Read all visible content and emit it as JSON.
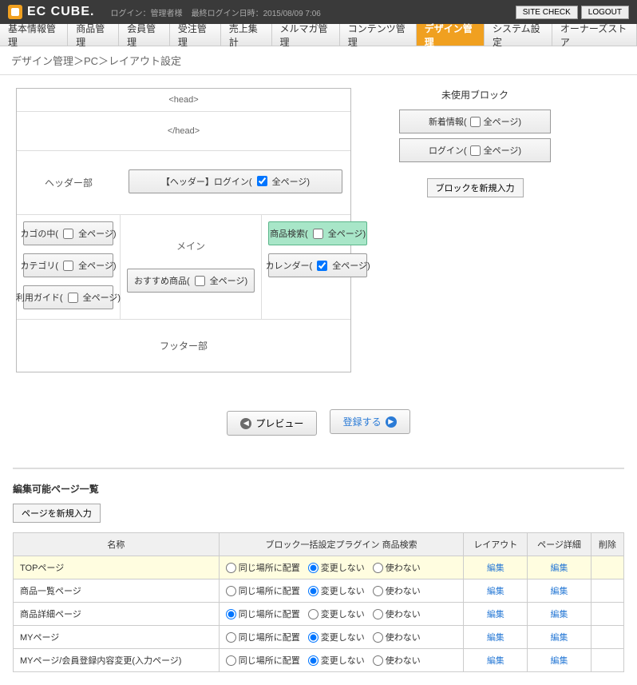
{
  "header": {
    "logo_text": "EC CUBE.",
    "login_label": "ログイン：",
    "login_user": "管理者様",
    "last_login_label": "最終ログイン日時：",
    "last_login": "2015/08/09 7:06",
    "site_check": "SITE CHECK",
    "logout": "LOGOUT"
  },
  "tabs": [
    "基本情報管理",
    "商品管理",
    "会員管理",
    "受注管理",
    "売上集計",
    "メルマガ管理",
    "コンテンツ管理",
    "デザイン管理",
    "システム設定",
    "オーナーズストア"
  ],
  "active_tab_index": 7,
  "breadcrumb": "デザイン管理＞PC＞レイアウト設定",
  "layout": {
    "head_open": "<head>",
    "head_close": "</head>",
    "header_label": "ヘッダー部",
    "main_label": "メイン",
    "footer_label": "フッター部",
    "all_pages_label": "全ページ",
    "header_blocks": [
      {
        "name": "【ヘッダー】ログイン(",
        "checked": true,
        "suffix": ")"
      }
    ],
    "left_blocks": [
      {
        "name": "カゴの中(",
        "checked": false,
        "suffix": ")"
      },
      {
        "name": "カテゴリ(",
        "checked": false,
        "suffix": ")"
      },
      {
        "name": "利用ガイド(",
        "checked": false,
        "suffix": ")"
      }
    ],
    "mid_blocks": [
      {
        "name": "おすすめ商品(",
        "checked": false,
        "suffix": ")"
      }
    ],
    "right_blocks": [
      {
        "name": "商品検索(",
        "checked": false,
        "suffix": ")",
        "highlight": true
      },
      {
        "name": "カレンダー(",
        "checked": true,
        "suffix": ")"
      }
    ]
  },
  "side": {
    "title": "未使用ブロック",
    "blocks": [
      {
        "name": "新着情報(",
        "checked": false,
        "suffix": ")"
      },
      {
        "name": "ログイン(",
        "checked": false,
        "suffix": ")"
      }
    ],
    "new_block": "ブロックを新規入力"
  },
  "actions": {
    "preview": "プレビュー",
    "register": "登録する"
  },
  "pages_section": {
    "title": "編集可能ページ一覧",
    "new_page": "ページを新規入力",
    "columns": [
      "名称",
      "ブロック一括設定プラグイン 商品検索",
      "レイアウト",
      "ページ詳細",
      "削除"
    ],
    "radio_labels": [
      "同じ場所に配置",
      "変更しない",
      "使わない"
    ],
    "edit": "編集",
    "rows": [
      {
        "name": "TOPページ",
        "selected": 1,
        "highlight": true
      },
      {
        "name": "商品一覧ページ",
        "selected": 1
      },
      {
        "name": "商品詳細ページ",
        "selected": 0
      },
      {
        "name": "MYページ",
        "selected": 1
      },
      {
        "name": "MYページ/会員登録内容変更(入力ページ)",
        "selected": 1
      }
    ]
  }
}
